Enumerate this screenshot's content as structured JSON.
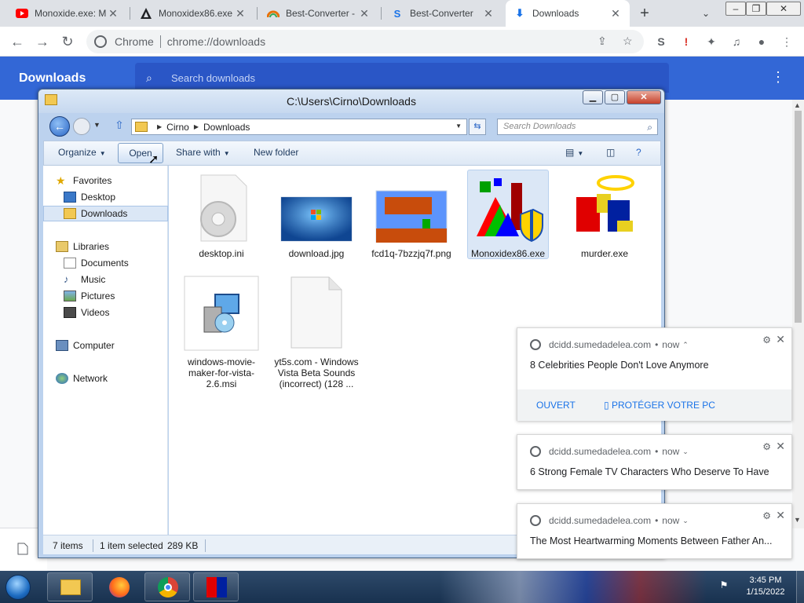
{
  "tabs": [
    {
      "title": "Monoxide.exe: M",
      "icon": "youtube-icon",
      "color": "#ff0000"
    },
    {
      "title": "Monoxidex86.exe",
      "icon": "logo-icon",
      "color": "#202124"
    },
    {
      "title": "Best-Converter -",
      "icon": "converter-icon",
      "color": "#e8710a"
    },
    {
      "title": "Best-Converter",
      "icon": "converter-s-icon",
      "color": "#1a73e8"
    },
    {
      "title": "Downloads",
      "icon": "download-icon",
      "color": "#1a73e8"
    }
  ],
  "toolbar": {
    "site_label": "Chrome",
    "url": "chrome://downloads"
  },
  "downloads_page": {
    "title": "Downloads",
    "search_placeholder": "Search downloads"
  },
  "explorer": {
    "title": "C:\\Users\\Cirno\\Downloads",
    "breadcrumb": [
      "Cirno",
      "Downloads"
    ],
    "search_placeholder": "Search Downloads",
    "commands": {
      "organize": "Organize",
      "open": "Open",
      "share_with": "Share with",
      "new_folder": "New folder"
    },
    "nav": {
      "favorites": "Favorites",
      "desktop": "Desktop",
      "downloads": "Downloads",
      "libraries": "Libraries",
      "documents": "Documents",
      "music": "Music",
      "pictures": "Pictures",
      "videos": "Videos",
      "computer": "Computer",
      "network": "Network"
    },
    "files": [
      {
        "name": "desktop.ini",
        "icon": "settings-file-icon"
      },
      {
        "name": "download.jpg",
        "icon": "image-file-icon"
      },
      {
        "name": "fcd1q-7bzzjq7f.png",
        "icon": "image-file-icon"
      },
      {
        "name": "Monoxidex86.exe",
        "icon": "exe-file-icon",
        "selected": true
      },
      {
        "name": "murder.exe",
        "icon": "exe-file-icon"
      },
      {
        "name": "windows-movie-maker-for-vista-2.6.msi",
        "icon": "installer-icon"
      },
      {
        "name": "yt5s.com - Windows Vista Beta Sounds (incorrect) (128 ...",
        "icon": "blank-file-icon"
      }
    ],
    "status": {
      "items": "7 items",
      "selected": "1 item selected",
      "size": "289 KB"
    }
  },
  "notifications": [
    {
      "source": "dcidd.sumedadelea.com",
      "time": "now",
      "message": "8 Celebrities People Don't Love Anymore",
      "actions": [
        "OUVERT",
        "▯ PROTÉGER VOTRE PC"
      ]
    },
    {
      "source": "dcidd.sumedadelea.com",
      "time": "now",
      "message": "6 Strong Female TV Characters Who Deserve To Have"
    },
    {
      "source": "dcidd.sumedadelea.com",
      "time": "now",
      "message": "The Most Heartwarming Moments Between Father An..."
    }
  ],
  "taskbar": {
    "time": "3:45 PM",
    "date": "1/15/2022"
  },
  "colors": {
    "chrome_blue": "#3367d6",
    "taskbar": "#1d3757",
    "selection": "#dbe7f6"
  }
}
